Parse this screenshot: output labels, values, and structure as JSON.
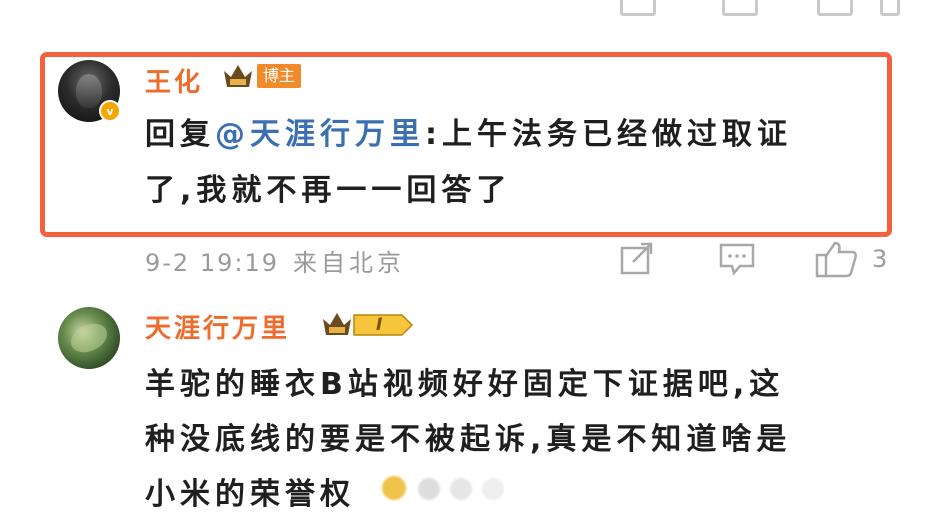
{
  "reply": {
    "author": "王化",
    "badge": "博主",
    "mention": "@天涯行万里",
    "reply_prefix": "回复",
    "text_line1": ":上午法务已经做过取证",
    "text_line2": "了,我就不再一一回答了",
    "timestamp": "9-2 19:19",
    "source": "来自北京",
    "like_count": "3"
  },
  "comment": {
    "author": "天涯行万里",
    "level": "I",
    "line1": "羊驼的睡衣B站视频好好固定下证据吧,这",
    "line2": "种没底线的要是不被起诉,真是不知道啥是",
    "line3": "小米的荣誉权"
  },
  "colors": {
    "highlight_border": "#f2603e",
    "username": "#ef6b2c",
    "mention": "#3b6fb3",
    "meta": "#9a9a9a"
  }
}
